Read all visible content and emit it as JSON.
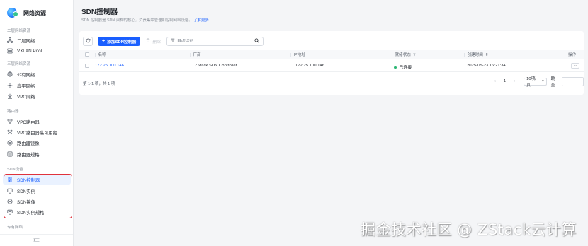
{
  "sidebar": {
    "brand": "网络资源",
    "groups": [
      {
        "title": "二层网络资源",
        "items": [
          {
            "label": "二层网络",
            "icon": "network-icon"
          },
          {
            "label": "VXLAN Pool",
            "icon": "pool-icon"
          }
        ]
      },
      {
        "title": "三层网络资源",
        "items": [
          {
            "label": "公有网络",
            "icon": "globe-icon"
          },
          {
            "label": "扁平网络",
            "icon": "flat-network-icon"
          },
          {
            "label": "VPC网络",
            "icon": "vpc-network-icon"
          }
        ]
      },
      {
        "title": "路由器",
        "items": [
          {
            "label": "VPC路由器",
            "icon": "router-icon"
          },
          {
            "label": "VPC路由器高可用组",
            "icon": "router-ha-icon"
          },
          {
            "label": "路由器镜像",
            "icon": "router-image-icon"
          },
          {
            "label": "路由器规格",
            "icon": "router-spec-icon"
          }
        ]
      },
      {
        "title": "SDN设备",
        "items": [
          {
            "label": "SDN控制器",
            "icon": "sdn-controller-icon",
            "active": true
          },
          {
            "label": "SDN实例",
            "icon": "sdn-instance-icon"
          },
          {
            "label": "SDN镜像",
            "icon": "sdn-image-icon"
          },
          {
            "label": "SDN实例规格",
            "icon": "sdn-spec-icon"
          }
        ]
      },
      {
        "title": "专有网络",
        "items": []
      }
    ]
  },
  "header": {
    "title": "SDN控制器",
    "description": "SDN 控制器是 SDN 架构的核心，负责集中管理和控制网络设备。",
    "learn_more": "了解更多"
  },
  "toolbar": {
    "add_label": "添加SDN控制器",
    "delete_label": "删除",
    "search_placeholder": "自动识别"
  },
  "table": {
    "columns": [
      "名称",
      "厂商",
      "IP地址",
      "就绪状态",
      "创建时间",
      "操作"
    ],
    "rows": [
      {
        "name": "172.25.100.146",
        "vendor": "ZStack SDN Controller",
        "ip": "172.25.100.146",
        "status": "已连接",
        "created": "2025-05-23 16:21:34",
        "action": "···"
      }
    ]
  },
  "pagination": {
    "total": "第 1-1 项，共 1 项",
    "current_page": "1",
    "page_size": "10项/页",
    "jump_label": "跳至"
  },
  "watermark": "掘金技术社区 @ ZStack云计算",
  "colors": {
    "accent": "#1a5fff",
    "status_ok": "#2bb673",
    "highlight": "#e0323c"
  }
}
